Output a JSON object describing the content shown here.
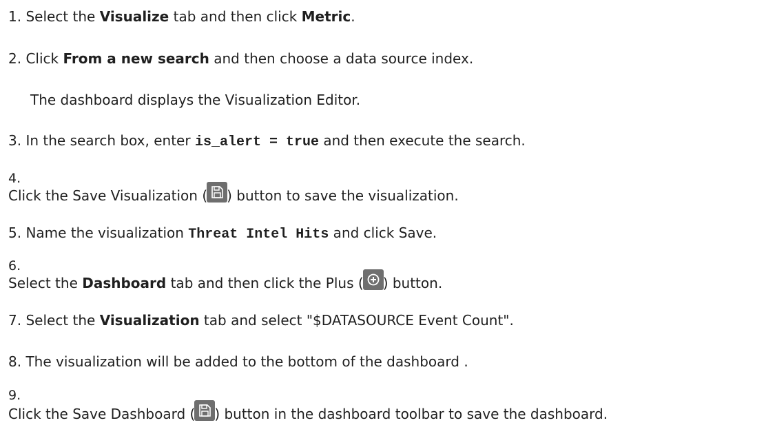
{
  "steps": [
    {
      "number": "1.",
      "parts": [
        "Select the ",
        "Visualize",
        " tab and then click ",
        "Metric",
        "."
      ]
    },
    {
      "number": "2.",
      "parts": [
        "Click ",
        "From a new search",
        " and then choose a data source index."
      ],
      "note": "The dashboard displays the Visualization Editor."
    },
    {
      "number": "3.",
      "parts": [
        "In the search box, enter ",
        "is_alert = true",
        " and then execute the search."
      ]
    },
    {
      "number": "4.",
      "parts": [
        "Click the Save Visualization (",
        ") button to save the visualization."
      ],
      "icon": "save-disk-icon"
    },
    {
      "number": "5.",
      "parts": [
        "Name the visualization ",
        "Threat Intel Hits",
        " and click Save."
      ]
    },
    {
      "number": "6.",
      "parts": [
        "Select the ",
        "Dashboard",
        " tab and then click the Plus (",
        ") button."
      ],
      "icon": "plus-circle-icon"
    },
    {
      "number": "7.",
      "parts": [
        "Select the ",
        "Visualization",
        " tab and select \"$DATASOURCE Event Count\"."
      ]
    },
    {
      "number": "8.",
      "parts": [
        "The visualization will be added to the bottom of the dashboard ."
      ]
    },
    {
      "number": "9.",
      "parts": [
        "Click the Save Dashboard (",
        ") button in the dashboard toolbar to save the dashboard."
      ],
      "icon": "save-disk-icon"
    }
  ],
  "colors": {
    "text": "#1f1f1f",
    "save_icon_bg": "#6e6e6e",
    "plus_icon_bg": "#6f6f6f"
  }
}
